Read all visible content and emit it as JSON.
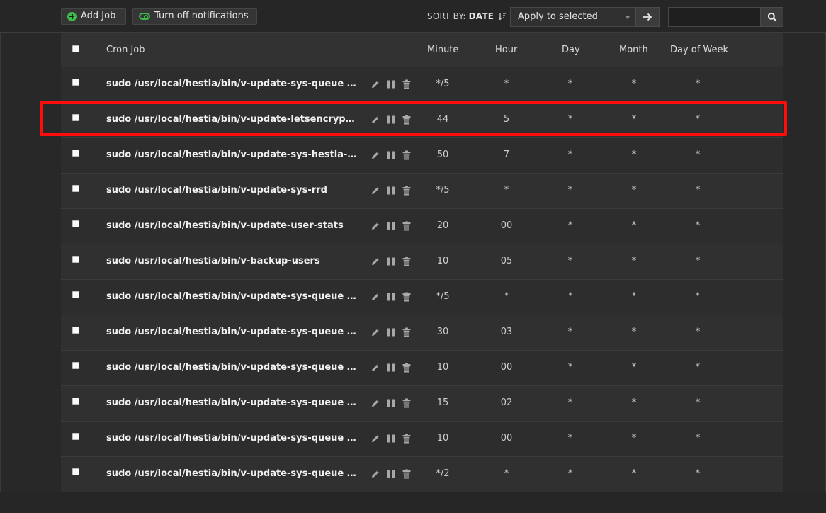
{
  "toolbar": {
    "add_job_label": "Add Job",
    "notifications_label": "Turn off notifications",
    "sort_by_label": "SORT BY:",
    "sort_by_value": "DATE",
    "bulk_action_selected": "Apply to selected",
    "search_placeholder": ""
  },
  "table": {
    "headers": {
      "cron_job": "Cron Job",
      "minute": "Minute",
      "hour": "Hour",
      "day": "Day",
      "month": "Month",
      "day_of_week": "Day of Week"
    },
    "rows": [
      {
        "command": "sudo /usr/local/hestia/bin/v-update-sys-queue letsencrypt",
        "minute": "*/5",
        "hour": "*",
        "day": "*",
        "month": "*",
        "dow": "*"
      },
      {
        "command": "sudo /usr/local/hestia/bin/v-update-letsencrypt-ssl",
        "minute": "44",
        "hour": "5",
        "day": "*",
        "month": "*",
        "dow": "*"
      },
      {
        "command": "sudo /usr/local/hestia/bin/v-update-sys-hestia-all",
        "minute": "50",
        "hour": "7",
        "day": "*",
        "month": "*",
        "dow": "*"
      },
      {
        "command": "sudo /usr/local/hestia/bin/v-update-sys-rrd",
        "minute": "*/5",
        "hour": "*",
        "day": "*",
        "month": "*",
        "dow": "*"
      },
      {
        "command": "sudo /usr/local/hestia/bin/v-update-user-stats",
        "minute": "20",
        "hour": "00",
        "day": "*",
        "month": "*",
        "dow": "*"
      },
      {
        "command": "sudo /usr/local/hestia/bin/v-backup-users",
        "minute": "10",
        "hour": "05",
        "day": "*",
        "month": "*",
        "dow": "*"
      },
      {
        "command": "sudo /usr/local/hestia/bin/v-update-sys-queue backup",
        "minute": "*/5",
        "hour": "*",
        "day": "*",
        "month": "*",
        "dow": "*"
      },
      {
        "command": "sudo /usr/local/hestia/bin/v-update-sys-queue webstats",
        "minute": "30",
        "hour": "03",
        "day": "*",
        "month": "*",
        "dow": "*"
      },
      {
        "command": "sudo /usr/local/hestia/bin/v-update-sys-queue traffic",
        "minute": "10",
        "hour": "00",
        "day": "*",
        "month": "*",
        "dow": "*"
      },
      {
        "command": "sudo /usr/local/hestia/bin/v-update-sys-queue disk",
        "minute": "15",
        "hour": "02",
        "day": "*",
        "month": "*",
        "dow": "*"
      },
      {
        "command": "sudo /usr/local/hestia/bin/v-update-sys-queue daily",
        "minute": "10",
        "hour": "00",
        "day": "*",
        "month": "*",
        "dow": "*"
      },
      {
        "command": "sudo /usr/local/hestia/bin/v-update-sys-queue restart",
        "minute": "*/2",
        "hour": "*",
        "day": "*",
        "month": "*",
        "dow": "*"
      }
    ]
  },
  "icons": {
    "add": "plus-circle-icon",
    "notifications": "toggle-icon",
    "sort": "sort-descending-icon",
    "go": "arrow-right-icon",
    "search": "search-icon",
    "edit": "pencil-icon",
    "suspend": "pause-icon",
    "delete": "trash-icon"
  },
  "colors": {
    "accent_green": "#3dbb4a",
    "highlight_red": "#ff0d0d",
    "background": "#282828"
  }
}
